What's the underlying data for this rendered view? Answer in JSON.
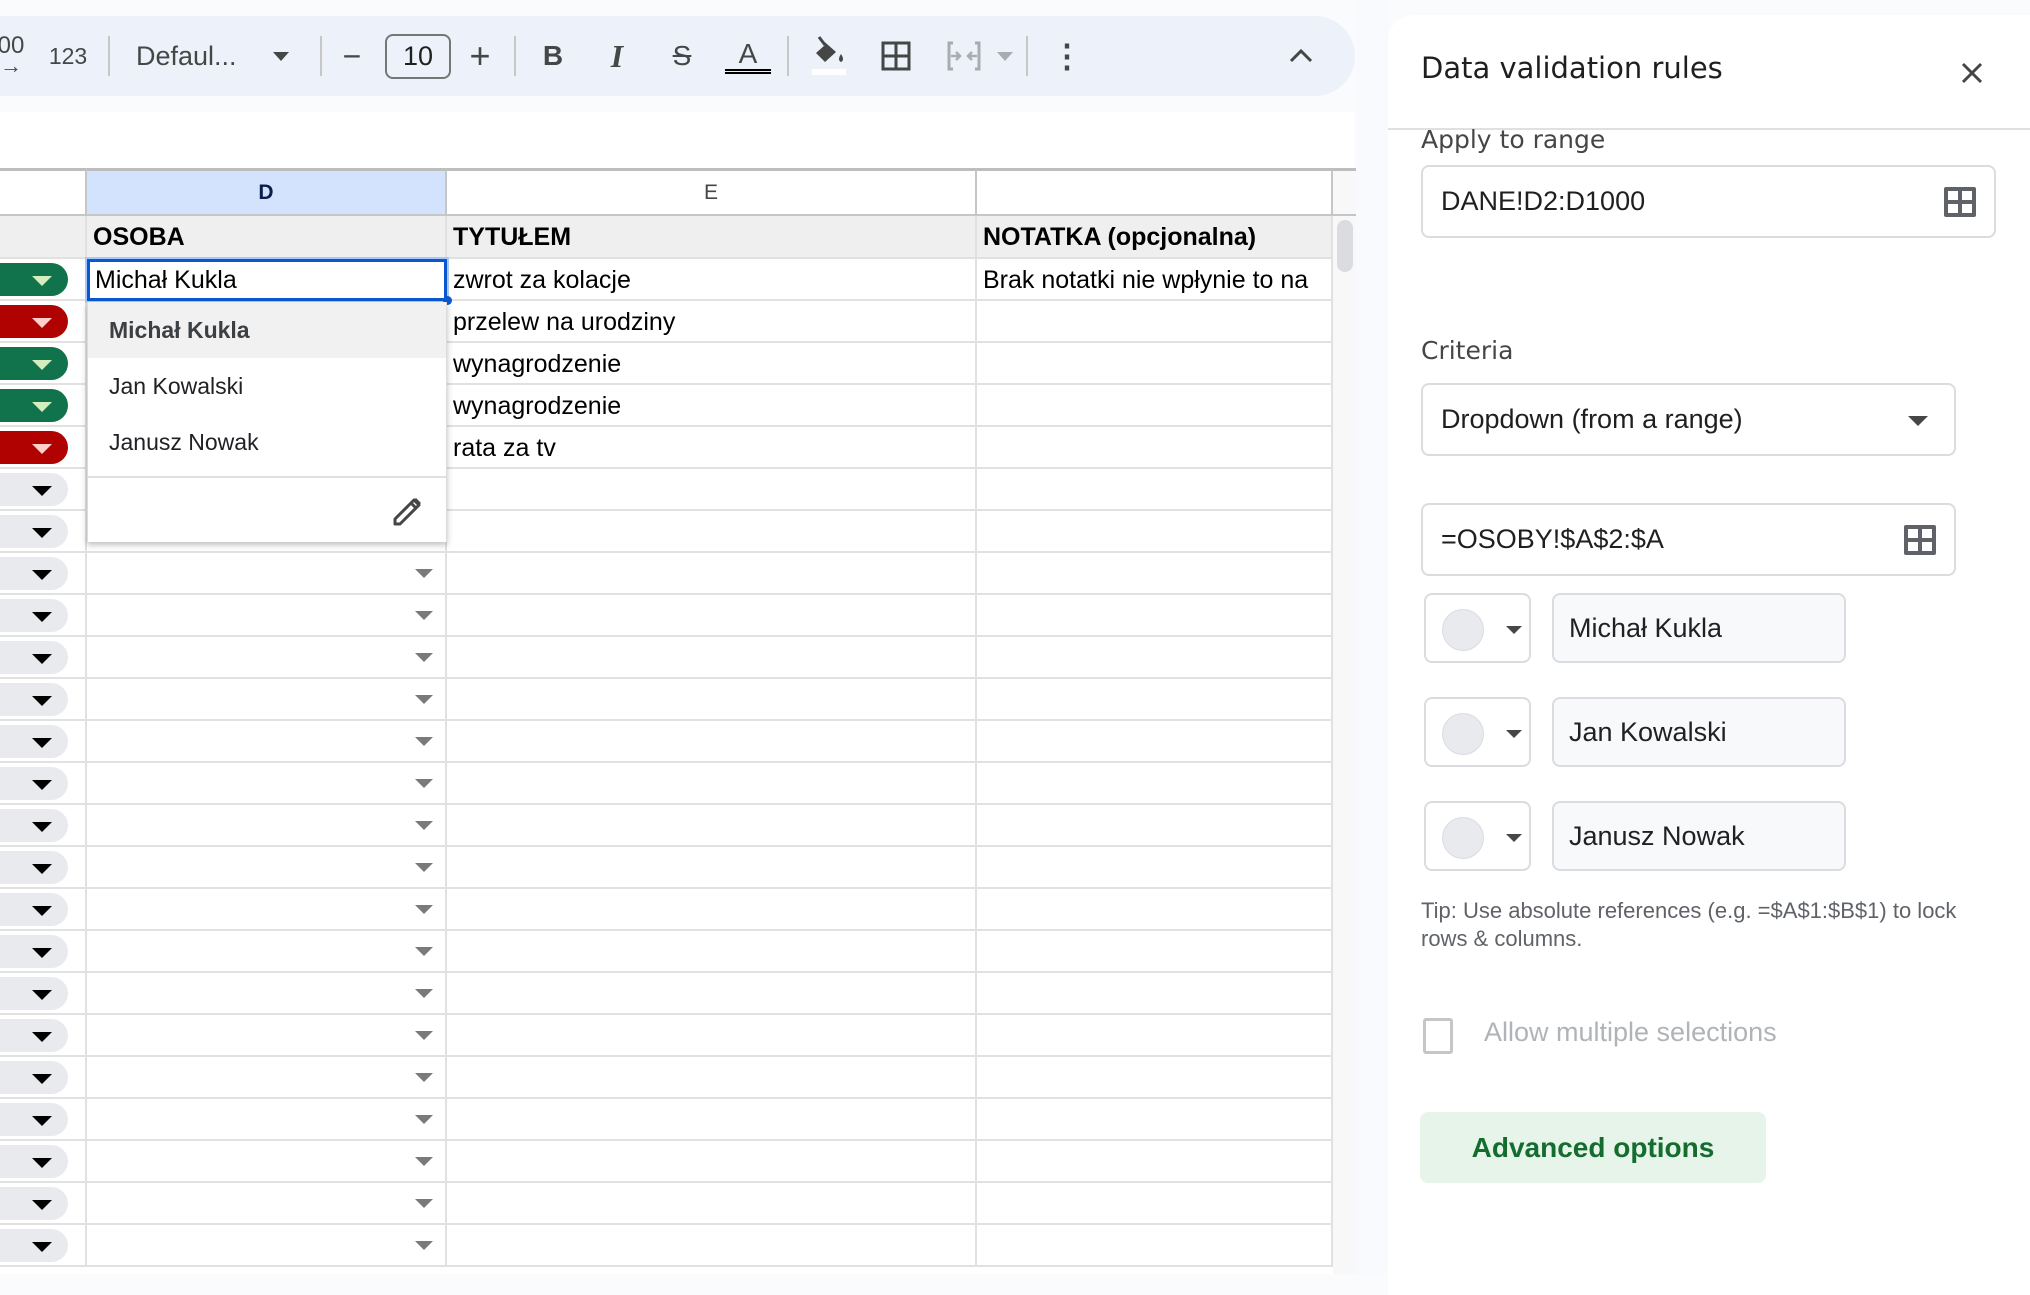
{
  "toolbar": {
    "increase_decimal_label": "00",
    "number_format_label": "123",
    "font_name": "Defaul...",
    "font_size": "10",
    "decrease_font_label": "−",
    "increase_font_label": "+",
    "bold_label": "B",
    "italic_label": "I",
    "strikethrough_label": "S",
    "text_color_label": "A",
    "more_label": "⋮"
  },
  "grid": {
    "columns": [
      {
        "id": "D",
        "label": "D",
        "selected": true
      },
      {
        "id": "E",
        "label": "E",
        "selected": false
      },
      {
        "id": "F",
        "label": "",
        "selected": false
      }
    ],
    "header_row": [
      "OSOBA",
      "TYTUŁEM",
      "NOTATKA (opcjonalna)"
    ],
    "rows": [
      {
        "status": "green",
        "osoba": "Michał Kukla",
        "tytulem": "zwrot za kolacje",
        "notatka": "Brak notatki nie wpłynie to na"
      },
      {
        "status": "red",
        "osoba": "",
        "tytulem": "przelew na urodziny",
        "notatka": ""
      },
      {
        "status": "green",
        "osoba": "",
        "tytulem": "wynagrodzenie",
        "notatka": ""
      },
      {
        "status": "green",
        "osoba": "",
        "tytulem": "wynagrodzenie",
        "notatka": ""
      },
      {
        "status": "red",
        "osoba": "",
        "tytulem": "rata za tv",
        "notatka": ""
      }
    ],
    "empty_rows": 19,
    "active_cell_value": "Michał Kukla"
  },
  "status_colors": {
    "green": "#11734b",
    "red": "#b10202",
    "empty": "#e8eaed"
  },
  "dropdown": {
    "options": [
      "Michał Kukla",
      "Jan Kowalski",
      "Janusz Nowak"
    ],
    "highlighted_index": 0
  },
  "panel": {
    "title": "Data validation rules",
    "apply_to_range_label": "Apply to range",
    "apply_to_range_value": "DANE!D2:D1000",
    "criteria_label": "Criteria",
    "criteria_value": "Dropdown (from a range)",
    "range_formula": "=OSOBY!$A$2:$A",
    "items": [
      "Michał Kukla",
      "Jan Kowalski",
      "Janusz Nowak"
    ],
    "tip": "Tip: Use absolute references (e.g. =$A$1:$B$1) to lock rows & columns.",
    "allow_multiple_label": "Allow multiple selections",
    "allow_multiple_checked": false,
    "advanced_button": "Advanced options"
  }
}
